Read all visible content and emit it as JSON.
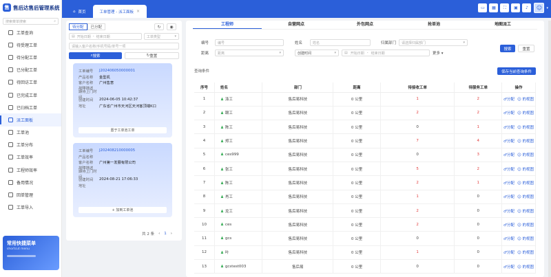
{
  "app": {
    "title": "售后达售后管理系统",
    "logo_letter": "售"
  },
  "sidebar": {
    "search_placeholder": "搜索菜单搜索",
    "search_icon": "search-icon",
    "items": [
      {
        "label": "工单查询"
      },
      {
        "label": "待受理工单"
      },
      {
        "label": "待分配工单"
      },
      {
        "label": "已分配工单"
      },
      {
        "label": "待回访工单"
      },
      {
        "label": "已完成工单"
      },
      {
        "label": "已归档工单"
      },
      {
        "label": "派工面板",
        "active": true
      },
      {
        "label": "工单池"
      },
      {
        "label": "工单分布"
      },
      {
        "label": "工单效率"
      },
      {
        "label": "工程师效率"
      },
      {
        "label": "备用情况"
      },
      {
        "label": "回单管理"
      },
      {
        "label": "工单导入"
      }
    ],
    "quick_menu": {
      "title": "常用快捷菜单",
      "subtitle": "shortcut menu"
    }
  },
  "tabs": [
    {
      "label": "首页",
      "icon": "home-icon"
    },
    {
      "label": "工单管理 - 派工面板",
      "active": true
    }
  ],
  "topbar_icons": [
    "monitor-icon",
    "table-icon",
    "fullscreen-icon",
    "lock-icon",
    "bell-icon"
  ],
  "left": {
    "segments": [
      "待分配",
      "已分配"
    ],
    "refresh_icon": "refresh-icon",
    "eye_icon": "eye-icon",
    "filters": {
      "start_date": "开始日期",
      "end_date": "结束日期",
      "order_type": "工单类型",
      "keyword": "请输入客户名称/手机号码/单号一项"
    },
    "search_label": "搜索",
    "reset_label": "重置",
    "card_labels": {
      "order_no": "工单编号",
      "product": "产品名称",
      "customer": "客户名称",
      "fault": "故障描述",
      "visit": "期待上门时间",
      "created": "创建时间",
      "address": "地址"
    },
    "cards": [
      {
        "order_no": "J202406050000001",
        "product": "金型机",
        "customer": "广州售意",
        "fault": "",
        "visit": "",
        "created": "2024-06-05 10:42:37",
        "address": "广东省广州市天河区天河客顶端K口",
        "button": "置于工单池工单"
      },
      {
        "order_no": "J202408210000005",
        "product": "",
        "customer": "广州第一发展有限公司",
        "fault": "",
        "visit": "",
        "created": "2024-08-21 17:06:33",
        "address": "",
        "button": "+ 加到工单池"
      }
    ],
    "pager": {
      "total": "共 2 条",
      "current": "1"
    }
  },
  "right": {
    "tabs": [
      "工程师",
      "自营网点",
      "外包网点",
      "抢单池",
      "地图派工"
    ],
    "search": {
      "code_label": "编号",
      "code_ph": "编号",
      "name_label": "姓名",
      "name_ph": "姓名",
      "dept_label": "归属部门",
      "dept_ph": "请选择归属部门",
      "distance_label": "距离",
      "distance_ph": "距离",
      "created_label": "创建时间",
      "start_ph": "开始日期",
      "end_ph": "结束日期",
      "more_label": "更多",
      "search_label": "搜索",
      "reset_label": "重置"
    },
    "query_label": "查询条件",
    "save_label": "保存当前查询条件",
    "columns": [
      "序号",
      "姓名",
      "部门",
      "距离",
      "待接收工单",
      "待服务工单",
      "操作"
    ],
    "op1": "♂分配",
    "op2": "☺ 的视图",
    "rows": [
      {
        "no": "1",
        "name": "涤工",
        "dept": "售后易科技",
        "dist": "0 公里",
        "recv": "1",
        "serve": "2"
      },
      {
        "no": "2",
        "name": "颐工",
        "dept": "售后易科技",
        "dist": "0 公里",
        "recv": "2",
        "serve": "2"
      },
      {
        "no": "3",
        "name": "陈工",
        "dept": "售后易科技",
        "dist": "0 公里",
        "recv": "0",
        "serve": "1"
      },
      {
        "no": "4",
        "name": "郑工",
        "dept": "售后易科技",
        "dist": "0 公里",
        "recv": "7",
        "serve": "4"
      },
      {
        "no": "5",
        "name": "ces999",
        "dept": "售后易科技",
        "dist": "0 公里",
        "recv": "0",
        "serve": "3"
      },
      {
        "no": "6",
        "name": "张工",
        "dept": "售后易科技",
        "dist": "0 公里",
        "recv": "5",
        "serve": "2"
      },
      {
        "no": "7",
        "name": "陈工",
        "dept": "售后易科技",
        "dist": "0 公里",
        "recv": "2",
        "serve": "1"
      },
      {
        "no": "8",
        "name": "肖工",
        "dept": "售后易科技",
        "dist": "0 公里",
        "recv": "1",
        "serve": "0"
      },
      {
        "no": "9",
        "name": "龙工",
        "dept": "售后易科技",
        "dist": "0 公里",
        "recv": "2",
        "serve": "0"
      },
      {
        "no": "10",
        "name": "ces",
        "dept": "售后易科技",
        "dist": "0 公里",
        "recv": "2",
        "serve": "0"
      },
      {
        "no": "11",
        "name": "gcs",
        "dept": "售后易科技",
        "dist": "0 公里",
        "recv": "0",
        "serve": "0"
      },
      {
        "no": "12",
        "name": "叶",
        "dept": "售后易科技",
        "dist": "0 公里",
        "recv": "1",
        "serve": "0"
      },
      {
        "no": "13",
        "name": "gcstest003",
        "dept": "售后易",
        "dist": "0 公里",
        "recv": "0",
        "serve": "0"
      }
    ]
  },
  "colors": {
    "primary": "#2b5fd9",
    "danger": "#e23b3b",
    "success": "#2fa84f"
  }
}
